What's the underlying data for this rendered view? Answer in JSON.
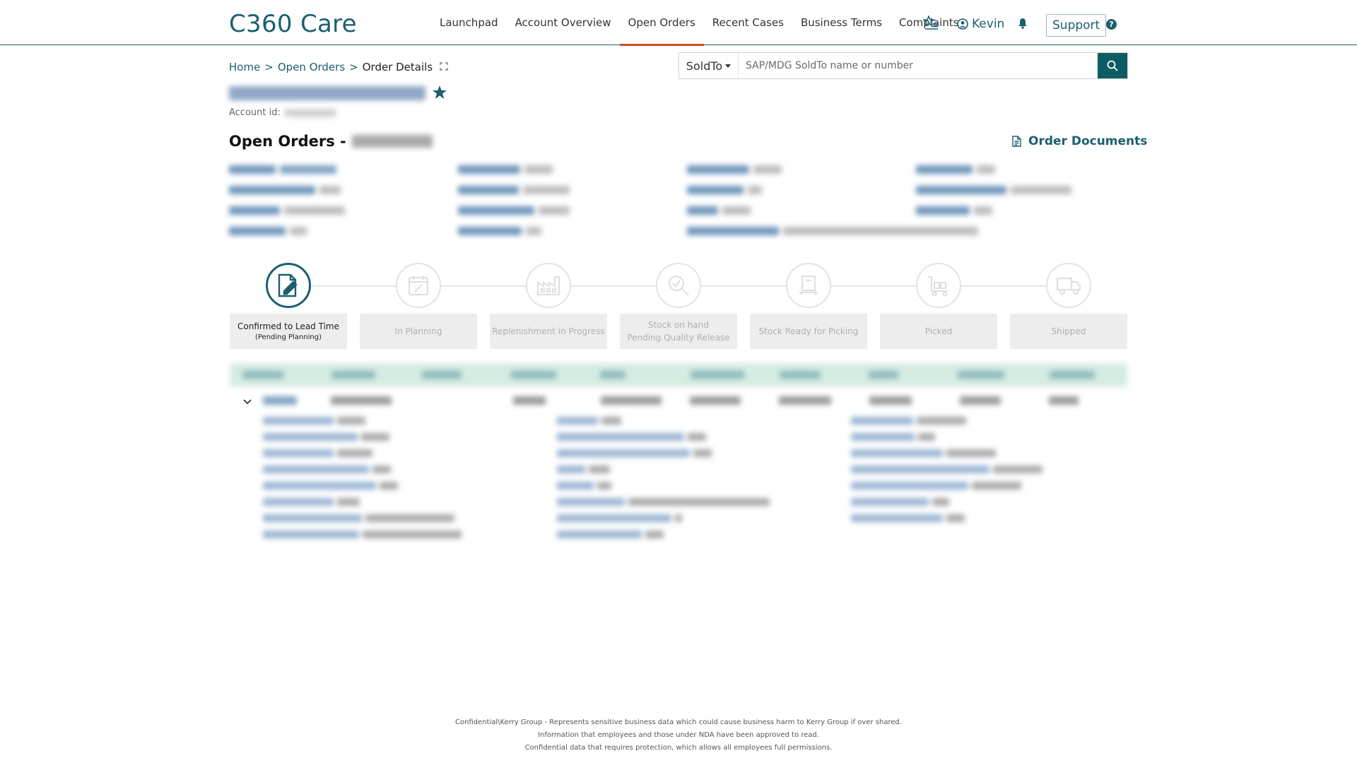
{
  "app": {
    "title": "C360 Care"
  },
  "nav": {
    "items": [
      {
        "label": "Launchpad",
        "active": false
      },
      {
        "label": "Account Overview",
        "active": false
      },
      {
        "label": "Open Orders",
        "active": true
      },
      {
        "label": "Recent Cases",
        "active": false
      },
      {
        "label": "Business Terms",
        "active": false
      },
      {
        "label": "Complaints",
        "active": false
      }
    ],
    "user": "Kevin",
    "support": "Support",
    "help": "?"
  },
  "breadcrumb": {
    "home": "Home",
    "open_orders": "Open Orders",
    "current": "Order Details",
    "sep": ">"
  },
  "search": {
    "scope": "SoldTo",
    "placeholder": "SAP/MDG SoldTo name or number"
  },
  "account": {
    "id_label": "Account id:"
  },
  "page": {
    "title": "Open Orders -",
    "order_documents": "Order Documents"
  },
  "steps": [
    {
      "label": "Confirmed to Lead Time",
      "sub": "(Pending Planning)",
      "active": true,
      "icon": "edit-document-icon"
    },
    {
      "label": "In Planning",
      "sub": "",
      "active": false,
      "icon": "calendar-icon"
    },
    {
      "label": "Replenishment in Progress",
      "sub": "",
      "active": false,
      "icon": "factory-icon"
    },
    {
      "label": "Stock on hand",
      "sub": "Pending Quality Release",
      "active": false,
      "icon": "magnify-icon"
    },
    {
      "label": "Stock Ready for Picking",
      "sub": "",
      "active": false,
      "icon": "pallet-icon"
    },
    {
      "label": "Picked",
      "sub": "",
      "active": false,
      "icon": "cart-icon"
    },
    {
      "label": "Shipped",
      "sub": "",
      "active": false,
      "icon": "truck-icon"
    }
  ],
  "footer": {
    "line1": "Confidential\\Kerry Group - Represents sensitive business data which could cause business harm to Kerry Group if over shared.",
    "line2": "Information that employees and those under NDA have been approved to read.",
    "line3": "Confidential data that requires protection, which allows all employees full permissions."
  },
  "colors": {
    "brand": "#1c5f6e",
    "accent": "#d4502e",
    "search_button": "#0d5c63",
    "table_header": "#d5ece2"
  }
}
